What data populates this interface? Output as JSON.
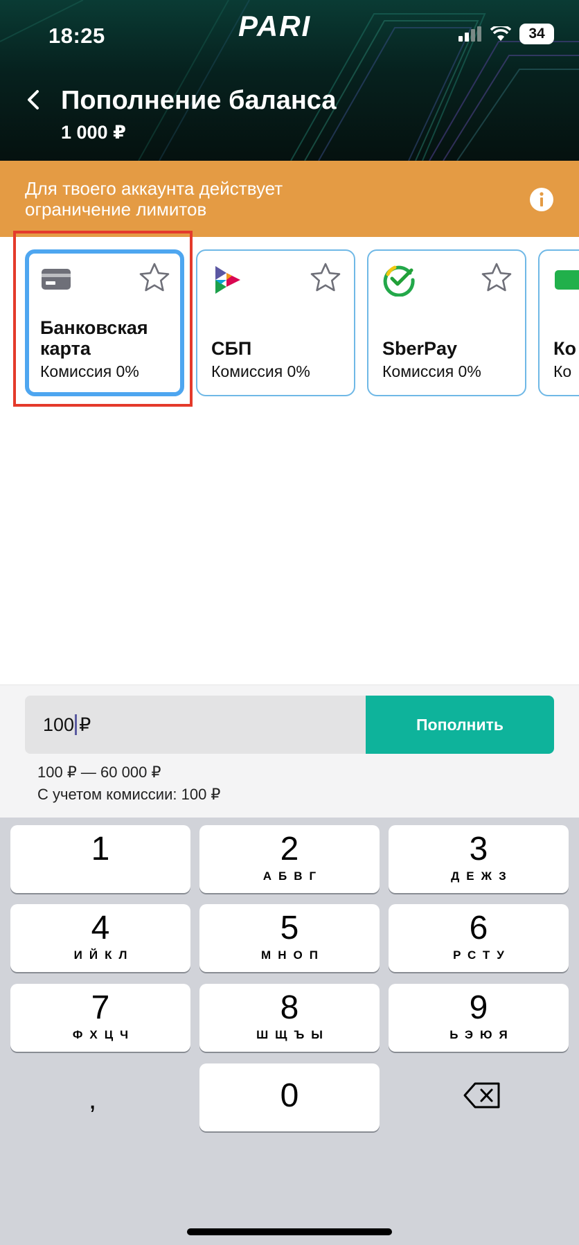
{
  "status_bar": {
    "time": "18:25",
    "battery": "34"
  },
  "brand": "PARI",
  "header": {
    "title": "Пополнение баланса",
    "amount": "1 000 ₽"
  },
  "banner": {
    "text": "Для твоего аккаунта действует ограничение лимитов"
  },
  "methods": [
    {
      "name": "Банковская карта",
      "fee": "Комиссия 0%",
      "icon": "bank-card-icon",
      "selected": true
    },
    {
      "name": "СБП",
      "fee": "Комиссия 0%",
      "icon": "sbp-logo-icon"
    },
    {
      "name": "SberPay",
      "fee": "Комиссия 0%",
      "icon": "sberpay-logo-icon"
    },
    {
      "name": "Ко ЦУ",
      "fee": "Ко",
      "icon": "cupis-logo-icon"
    }
  ],
  "amount": {
    "value": "100",
    "currency": "₽",
    "submit_label": "Пополнить",
    "range": "100 ₽ — 60 000 ₽",
    "commission": "С учетом комиссии: 100 ₽"
  },
  "keyboard": {
    "keys": [
      {
        "num": "1",
        "letters": ""
      },
      {
        "num": "2",
        "letters": "АБВГ"
      },
      {
        "num": "3",
        "letters": "ДЕЖЗ"
      },
      {
        "num": "4",
        "letters": "ИЙКЛ"
      },
      {
        "num": "5",
        "letters": "МНОП"
      },
      {
        "num": "6",
        "letters": "РСТУ"
      },
      {
        "num": "7",
        "letters": "ФХЦЧ"
      },
      {
        "num": "8",
        "letters": "ШЩЪЫ"
      },
      {
        "num": "9",
        "letters": "ЬЭЮЯ"
      },
      {
        "num": "0",
        "letters": ""
      }
    ],
    "comma": ","
  },
  "colors": {
    "accent": "#0eb39b",
    "banner": "#e49b44",
    "selected_border": "#4ea6f0",
    "highlight": "#e43a2b"
  }
}
